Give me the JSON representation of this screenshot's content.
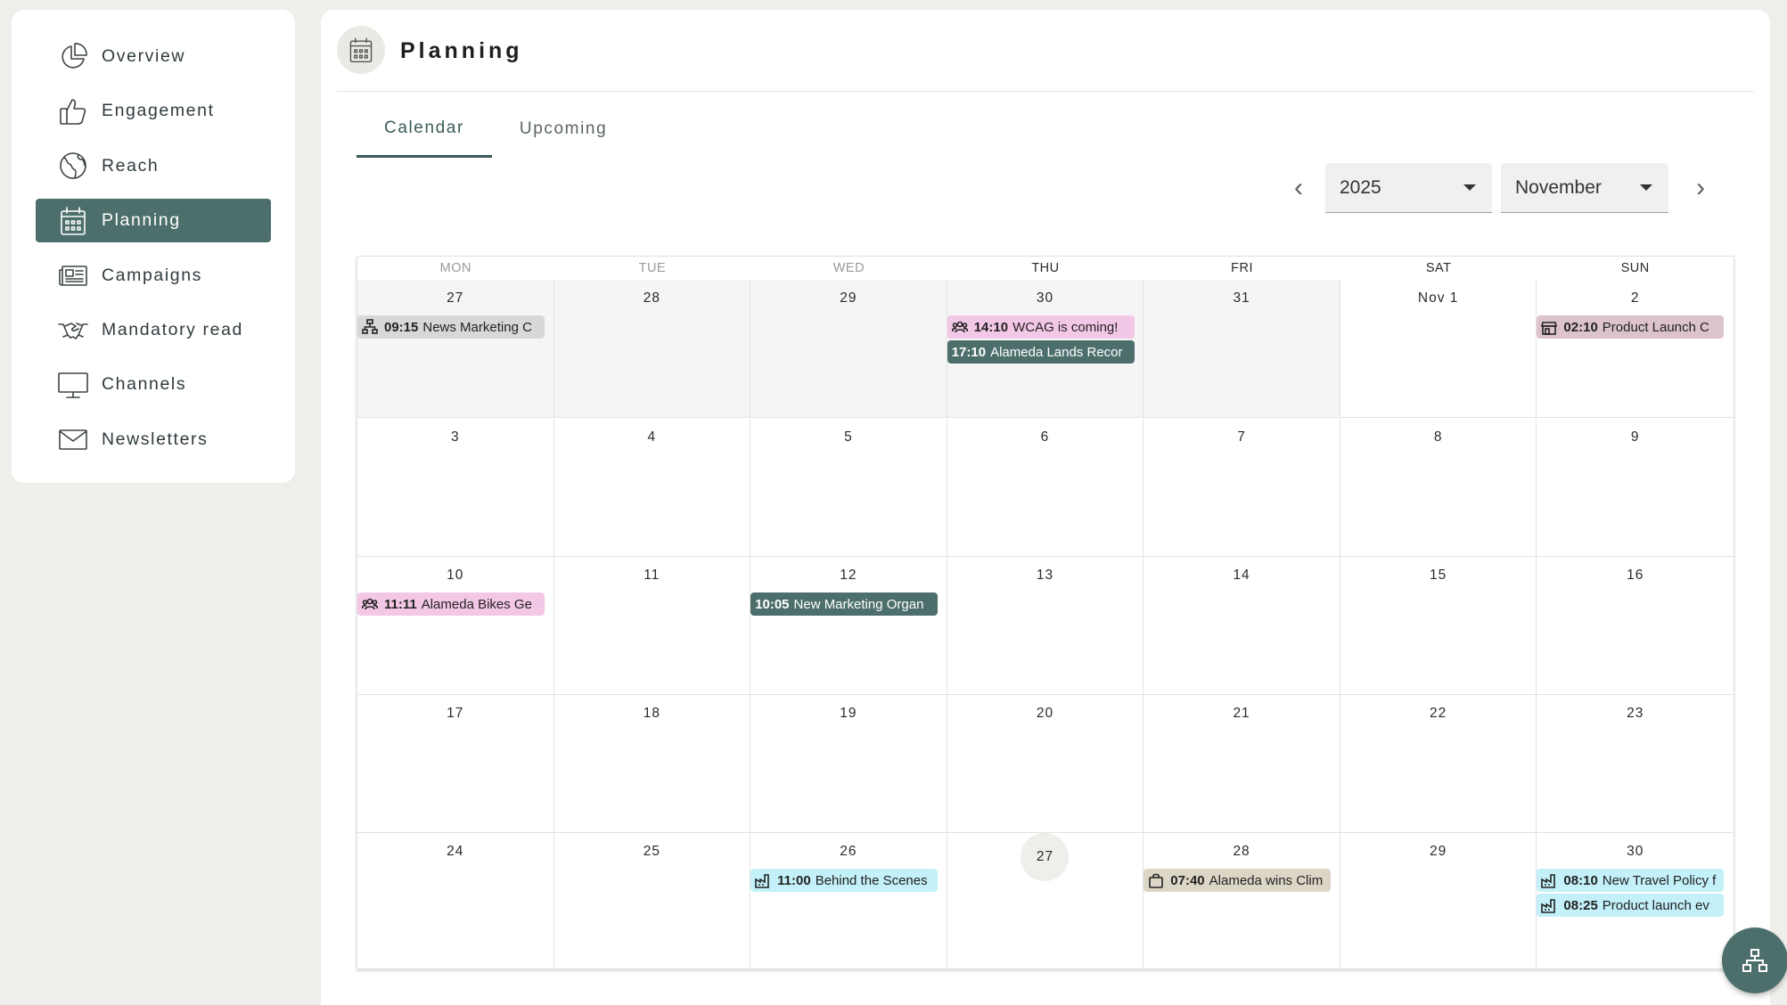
{
  "sidebar": {
    "items": [
      {
        "label": "Overview",
        "icon": "pie-chart-icon"
      },
      {
        "label": "Engagement",
        "icon": "thumbs-up-icon"
      },
      {
        "label": "Reach",
        "icon": "globe-icon"
      },
      {
        "label": "Planning",
        "icon": "calendar-icon",
        "active": true
      },
      {
        "label": "Campaigns",
        "icon": "newspaper-icon"
      },
      {
        "label": "Mandatory read",
        "icon": "handshake-icon"
      },
      {
        "label": "Channels",
        "icon": "monitor-icon"
      },
      {
        "label": "Newsletters",
        "icon": "mail-icon"
      }
    ]
  },
  "header": {
    "title": "Planning",
    "icon": "calendar-icon"
  },
  "tabs": [
    {
      "label": "Calendar",
      "active": true
    },
    {
      "label": "Upcoming",
      "active": false
    }
  ],
  "controls": {
    "year": "2025",
    "month": "November"
  },
  "calendar": {
    "weekdays": [
      "MON",
      "TUE",
      "WED",
      "THU",
      "FRI",
      "SAT",
      "SUN"
    ],
    "weeks": [
      [
        "27",
        "28",
        "29",
        "30",
        "31",
        "Nov 1",
        "2"
      ],
      [
        "3",
        "4",
        "5",
        "6",
        "7",
        "8",
        "9"
      ],
      [
        "10",
        "11",
        "12",
        "13",
        "14",
        "15",
        "16"
      ],
      [
        "17",
        "18",
        "19",
        "20",
        "21",
        "22",
        "23"
      ],
      [
        "24",
        "25",
        "26",
        "27",
        "28",
        "29",
        "30"
      ]
    ],
    "today": "27",
    "events": [
      {
        "week": 0,
        "day": 0,
        "slot": 0,
        "time": "09:15",
        "title": "News Marketing C",
        "icon": "org-chart-icon"
      },
      {
        "week": 0,
        "day": 3,
        "slot": 0,
        "time": "14:10",
        "title": "WCAG is coming!",
        "icon": "group-icon"
      },
      {
        "week": 0,
        "day": 3,
        "slot": 1,
        "time": "17:10",
        "title": "Alameda Lands Recor",
        "icon": ""
      },
      {
        "week": 0,
        "day": 6,
        "slot": 0,
        "time": "02:10",
        "title": "Product Launch C",
        "icon": "store-icon"
      },
      {
        "week": 2,
        "day": 0,
        "slot": 0,
        "time": "11:11",
        "title": "Alameda Bikes Ge",
        "icon": "group-icon"
      },
      {
        "week": 2,
        "day": 2,
        "slot": 0,
        "time": "10:05",
        "title": "New Marketing Organ",
        "icon": ""
      },
      {
        "week": 4,
        "day": 2,
        "slot": 0,
        "time": "11:00",
        "title": "Behind the Scenes",
        "icon": "factory-icon"
      },
      {
        "week": 4,
        "day": 4,
        "slot": 0,
        "time": "07:40",
        "title": "Alameda wins Clim",
        "icon": "bag-icon"
      },
      {
        "week": 4,
        "day": 6,
        "slot": 0,
        "time": "08:10",
        "title": "New Travel Policy f",
        "icon": "factory-icon"
      },
      {
        "week": 4,
        "day": 6,
        "slot": 1,
        "time": "08:25",
        "title": "Product launch ev",
        "icon": "factory-icon"
      }
    ]
  },
  "colors": {
    "accent": "#4d6f6c",
    "event_gray": "#d8d8d8",
    "event_pink": "#f3c7e6",
    "event_teal": "#4d6f6c",
    "event_mauve": "#dcc3cd",
    "event_cyan": "#c3f0f9",
    "event_tan": "#dcd6c6"
  },
  "fab": {
    "icon": "org-chart-icon"
  }
}
